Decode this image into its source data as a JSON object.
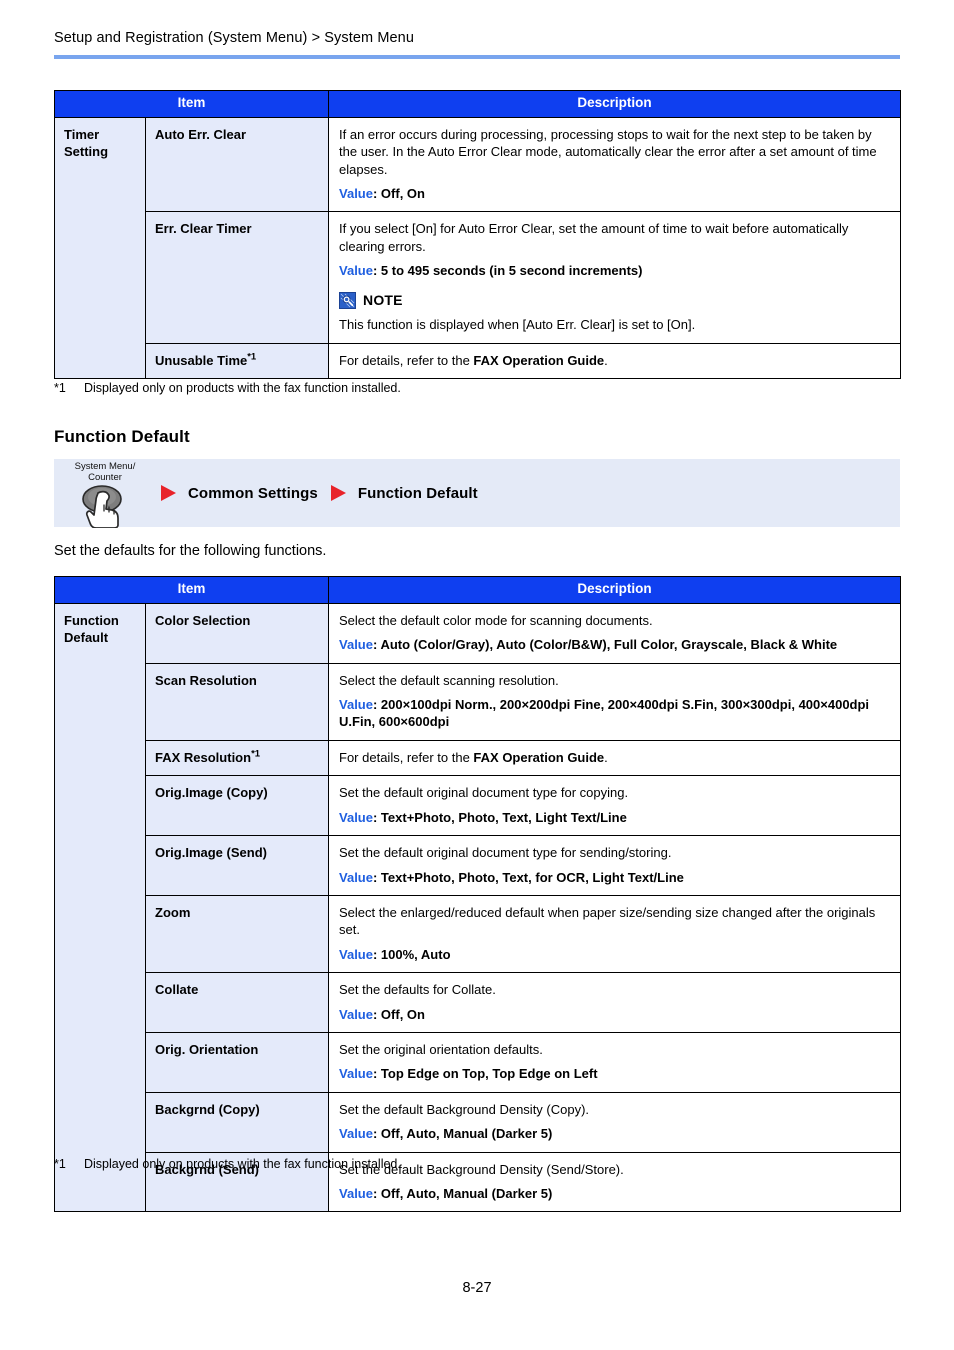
{
  "header": {
    "breadcrumb": "Setup and Registration (System Menu) > System Menu"
  },
  "colors": {
    "table_header_blue": "#0F3FF0",
    "item_cell_blue": "#E4EAFA",
    "rule_blue": "#79A5EE",
    "value_label_blue": "#1F5FE0",
    "nav_box_blue": "#E4EAF7",
    "arrow_red": "#E8232A",
    "note_icon_blue": "#2B60C8"
  },
  "table1": {
    "columns": [
      "Item",
      "Description"
    ],
    "group_label": "Timer\nSetting",
    "group_label_line1": "Timer",
    "group_label_line2": "Setting",
    "rows": [
      {
        "item": "Auto Err. Clear",
        "footnote_mark": "",
        "desc": "If an error occurs during processing, processing stops to wait for the next step to be taken by the user. In the Auto Error Clear mode, automatically clear the error after a set amount of time elapses.",
        "value_label": "Value",
        "value": ": Off, On"
      },
      {
        "item": "Err. Clear Timer",
        "footnote_mark": "",
        "desc": "If you select [On] for Auto Error Clear, set the amount of time to wait before automatically clearing errors.",
        "value_label": "Value",
        "value": ": 5 to 495 seconds (in 5 second increments)",
        "note": {
          "icon": "note-magnifier-icon",
          "title": "NOTE",
          "body": "This function is displayed when [Auto Err. Clear] is set to [On]."
        }
      },
      {
        "item": "Unusable Time",
        "footnote_mark": "*1",
        "desc_prefix": "For details, refer to the ",
        "desc_bold": "FAX Operation Guide",
        "desc_suffix": "."
      }
    ],
    "footnote": {
      "mark": "*1",
      "text": "Displayed only on products with the fax function installed."
    }
  },
  "section": {
    "heading": "Function Default",
    "nav": {
      "key_label_line1": "System Menu/",
      "key_label_line2": "Counter",
      "key_icon": "system-menu-counter-key-icon",
      "steps": [
        "Common Settings",
        "Function Default"
      ]
    },
    "intro": "Set the defaults for the following functions."
  },
  "table2": {
    "columns": [
      "Item",
      "Description"
    ],
    "group_label_line1": "Function",
    "group_label_line2": "Default",
    "rows": [
      {
        "item": "Color Selection",
        "footnote_mark": "",
        "desc": "Select the default color mode for scanning documents.",
        "value_label": "Value",
        "value": ": Auto (Color/Gray), Auto (Color/B&W), Full Color, Grayscale, Black & White"
      },
      {
        "item": "Scan Resolution",
        "footnote_mark": "",
        "desc": "Select the default scanning resolution.",
        "value_label": "Value",
        "value": ": 200×100dpi Norm., 200×200dpi Fine, 200×400dpi S.Fin, 300×300dpi, 400×400dpi U.Fin, 600×600dpi"
      },
      {
        "item": "FAX Resolution",
        "footnote_mark": "*1",
        "desc_prefix": "For details, refer to the ",
        "desc_bold": "FAX Operation Guide",
        "desc_suffix": "."
      },
      {
        "item": "Orig.Image (Copy)",
        "footnote_mark": "",
        "desc": "Set the default original document type for copying.",
        "value_label": "Value",
        "value": ": Text+Photo, Photo, Text, Light Text/Line"
      },
      {
        "item": "Orig.Image (Send)",
        "footnote_mark": "",
        "desc": "Set the default original document type for sending/storing.",
        "value_label": "Value",
        "value": ": Text+Photo, Photo, Text, for OCR, Light Text/Line"
      },
      {
        "item": "Zoom",
        "footnote_mark": "",
        "desc": "Select the enlarged/reduced default when paper size/sending size changed after the originals set.",
        "value_label": "Value",
        "value": ": 100%, Auto"
      },
      {
        "item": "Collate",
        "footnote_mark": "",
        "desc": "Set the defaults for Collate.",
        "value_label": "Value",
        "value": ": Off, On"
      },
      {
        "item": "Orig. Orientation",
        "footnote_mark": "",
        "desc": "Set the original orientation defaults.",
        "value_label": "Value",
        "value": ": Top Edge on Top, Top Edge on Left"
      },
      {
        "item": "Backgrnd (Copy)",
        "footnote_mark": "",
        "desc": "Set the default Background Density (Copy).",
        "value_label": "Value",
        "value": ": Off, Auto, Manual (Darker 5)"
      },
      {
        "item": "Backgrnd (Send)",
        "footnote_mark": "",
        "desc": "Set the default Background Density (Send/Store).",
        "value_label": "Value",
        "value": ": Off, Auto, Manual (Darker 5)"
      }
    ],
    "footnote": {
      "mark": "*1",
      "text": "Displayed only on products with the fax function installed."
    }
  },
  "footer": {
    "page_number": "8-27"
  }
}
